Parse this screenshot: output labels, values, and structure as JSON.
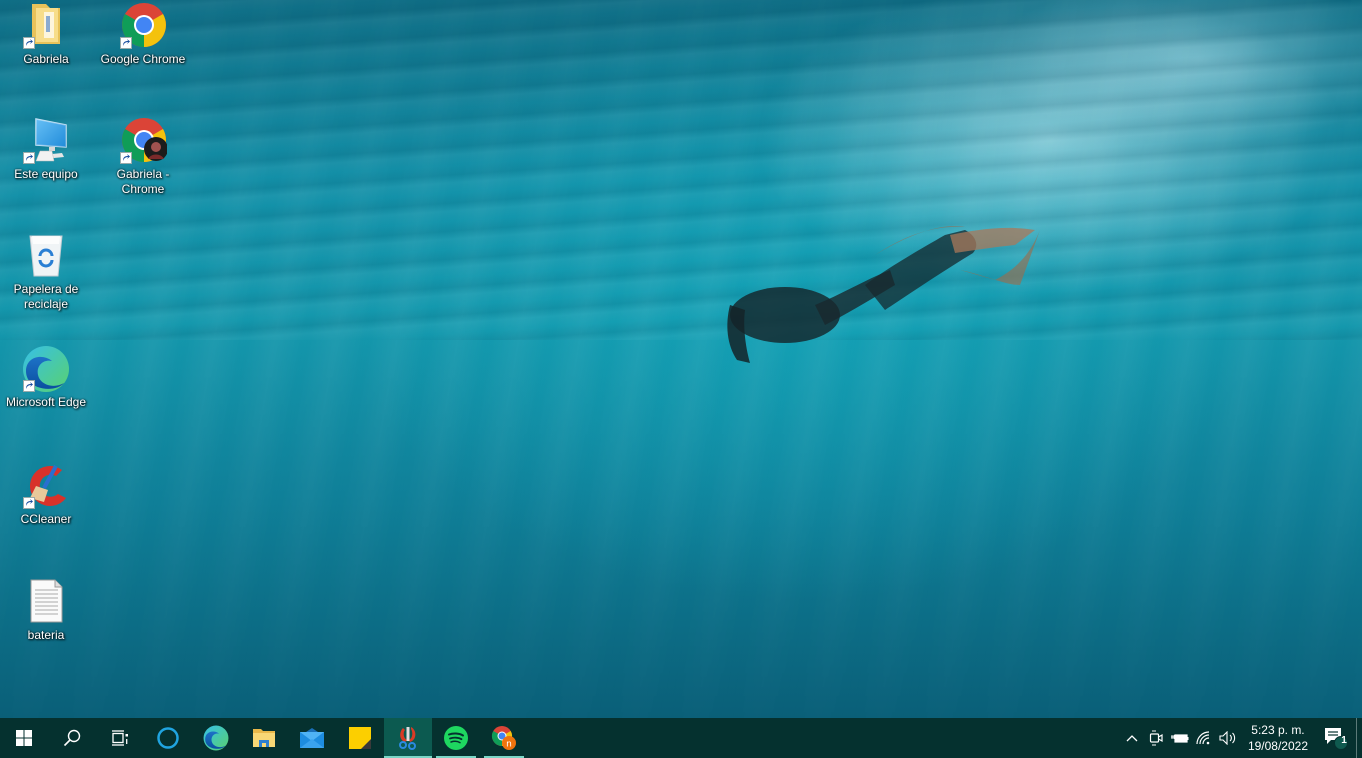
{
  "desktop": {
    "icons": [
      {
        "label": "Gabriela",
        "icon": "folder-icon"
      },
      {
        "label": "Google Chrome",
        "icon": "chrome-icon"
      },
      {
        "label": "Este equipo",
        "icon": "computer-icon"
      },
      {
        "label": "Gabriela - Chrome",
        "icon": "chrome-profile-icon"
      },
      {
        "label": "Papelera de reciclaje",
        "icon": "recycle-bin-icon"
      },
      {
        "label": "Microsoft Edge",
        "icon": "edge-icon"
      },
      {
        "label": "CCleaner",
        "icon": "ccleaner-icon"
      },
      {
        "label": "bateria",
        "icon": "text-file-icon"
      }
    ]
  },
  "taskbar": {
    "start": "start-icon",
    "search": "search-icon",
    "task_view": "task-view-icon",
    "apps": [
      {
        "name": "Cortana",
        "icon": "cortana-icon",
        "running": false
      },
      {
        "name": "Microsoft Edge",
        "icon": "edge-icon",
        "running": false
      },
      {
        "name": "File Explorer",
        "icon": "file-explorer-icon",
        "running": false
      },
      {
        "name": "Mail",
        "icon": "mail-icon",
        "running": false
      },
      {
        "name": "Sticky Notes",
        "icon": "sticky-notes-icon",
        "running": false
      },
      {
        "name": "Snipping Tool",
        "icon": "snipping-tool-icon",
        "running": true,
        "active": true
      },
      {
        "name": "Spotify",
        "icon": "spotify-icon",
        "running": true
      },
      {
        "name": "Google Chrome",
        "icon": "chrome-icon",
        "running": true
      }
    ],
    "tray": {
      "icons": [
        "chevron-up-icon",
        "meet-now-icon",
        "battery-icon",
        "wifi-icon",
        "volume-icon"
      ],
      "time": "5:23 p. m.",
      "date": "19/08/2022",
      "notification_count": "1"
    }
  },
  "colors": {
    "taskbar_bg": "#05312f",
    "taskbar_active": "#0c5a50",
    "running_indicator": "#7ad6c6"
  }
}
